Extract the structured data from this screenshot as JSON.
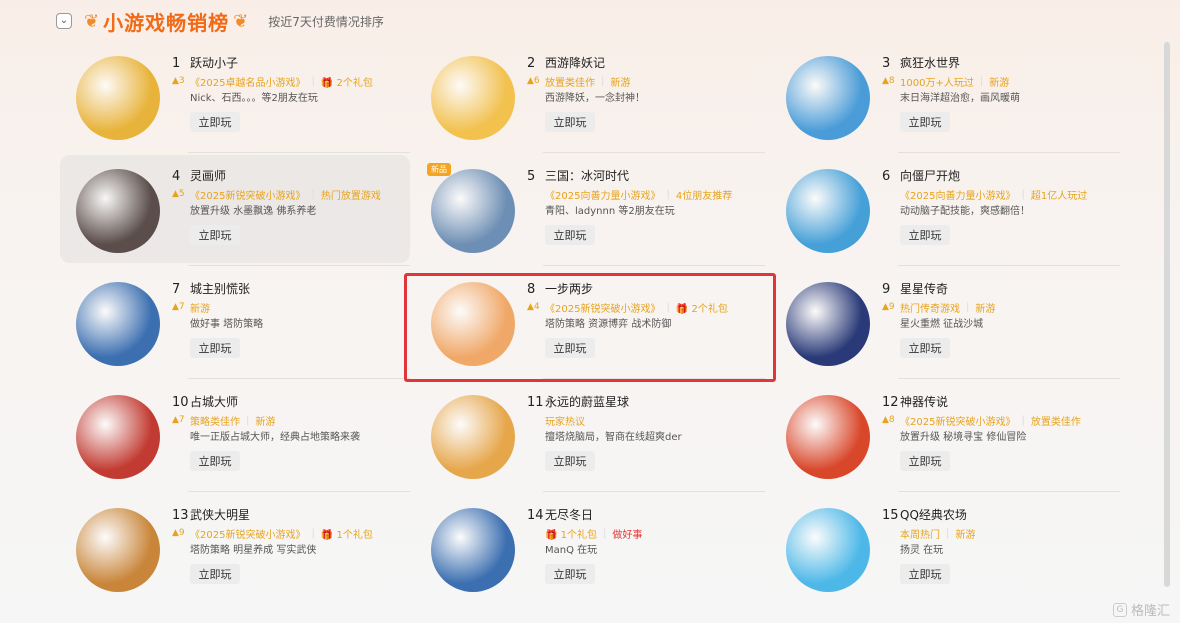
{
  "header": {
    "collapse_icon": "chevron-down-icon",
    "laurel_left": "❦",
    "title": "小游戏畅销榜",
    "laurel_right": "❦",
    "subtitle": "按近7天付费情况排序"
  },
  "play_label": "立即玩",
  "games": [
    {
      "rank": "1",
      "name": "跃动小子",
      "trend": "▲3",
      "tags": [
        "《2025卓越名品小游戏》",
        "🎁 2个礼包"
      ],
      "desc": "Nick、石西。。。等2朋友在玩",
      "color": "#e8b33a"
    },
    {
      "rank": "2",
      "name": "西游降妖记",
      "trend": "▲6",
      "tags": [
        "放置类佳作",
        "新游"
      ],
      "desc": "西游降妖，一念封神！",
      "color": "#f2c14e"
    },
    {
      "rank": "3",
      "name": "疯狂水世界",
      "trend": "▲8",
      "tags": [
        "1000万+人玩过",
        "新游"
      ],
      "desc": "末日海洋超治愈，画风暖萌",
      "color": "#4a9cd8"
    },
    {
      "rank": "4",
      "name": "灵画师",
      "trend": "▲5",
      "tags": [
        "《2025新锐突破小游戏》",
        "热门放置游戏"
      ],
      "desc": "放置升级  水墨飘逸  佛系养老",
      "color": "#5a4d4a"
    },
    {
      "rank": "5",
      "name": "三国：冰河时代",
      "trend": "",
      "tags": [
        "《2025向善力量小游戏》",
        "4位朋友推荐"
      ],
      "desc": "青阳、ladynnn 等2朋友在玩",
      "color": "#6e8fb5",
      "new_badge": "新品"
    },
    {
      "rank": "6",
      "name": "向僵尸开炮",
      "trend": "",
      "tags": [
        "《2025向善力量小游戏》",
        "超1亿人玩过"
      ],
      "desc": "动动脑子配技能，爽感翻倍！",
      "color": "#45a0d8"
    },
    {
      "rank": "7",
      "name": "城主别慌张",
      "trend": "▲7",
      "tags": [
        "新游"
      ],
      "desc": "做好事  塔防策略",
      "color": "#3b6fb0"
    },
    {
      "rank": "8",
      "name": "一步两步",
      "trend": "▲4",
      "tags": [
        "《2025新锐突破小游戏》",
        "🎁 2个礼包"
      ],
      "desc": "塔防策略  资源博弈  战术防御",
      "color": "#f0a868"
    },
    {
      "rank": "9",
      "name": "星星传奇",
      "trend": "▲9",
      "tags": [
        "热门传奇游戏",
        "新游"
      ],
      "desc": "星火重燃 征战沙城",
      "color": "#2a3a78"
    },
    {
      "rank": "10",
      "name": "占城大师",
      "trend": "▲7",
      "tags": [
        "策略类佳作",
        "新游"
      ],
      "desc": "唯一正版占城大师，经典占地策略来袭",
      "color": "#c23b32"
    },
    {
      "rank": "11",
      "name": "永远的蔚蓝星球",
      "trend": "",
      "tags": [
        "玩家热议"
      ],
      "desc": "擅塔烧脑局，智商在线超爽der",
      "color": "#e6a64a"
    },
    {
      "rank": "12",
      "name": "神器传说",
      "trend": "▲8",
      "tags": [
        "《2025新锐突破小游戏》",
        "放置类佳作"
      ],
      "desc": "放置升级  秘境寻宝  修仙冒险",
      "color": "#d9472b"
    },
    {
      "rank": "13",
      "name": "武侠大明星",
      "trend": "▲9",
      "tags": [
        "《2025新锐突破小游戏》",
        "🎁 1个礼包"
      ],
      "desc": "塔防策略  明星养成  写实武侠",
      "color": "#c9863a"
    },
    {
      "rank": "14",
      "name": "无尽冬日",
      "trend": "",
      "tags": [
        "🎁 1个礼包",
        "做好事"
      ],
      "desc": "ManQ 在玩",
      "color": "#3c6fb0"
    },
    {
      "rank": "15",
      "name": "QQ经典农场",
      "trend": "",
      "tags": [
        "本周热门",
        "新游"
      ],
      "desc": "扬灵 在玩",
      "color": "#4db8e8"
    }
  ],
  "watermark": "格隆汇"
}
